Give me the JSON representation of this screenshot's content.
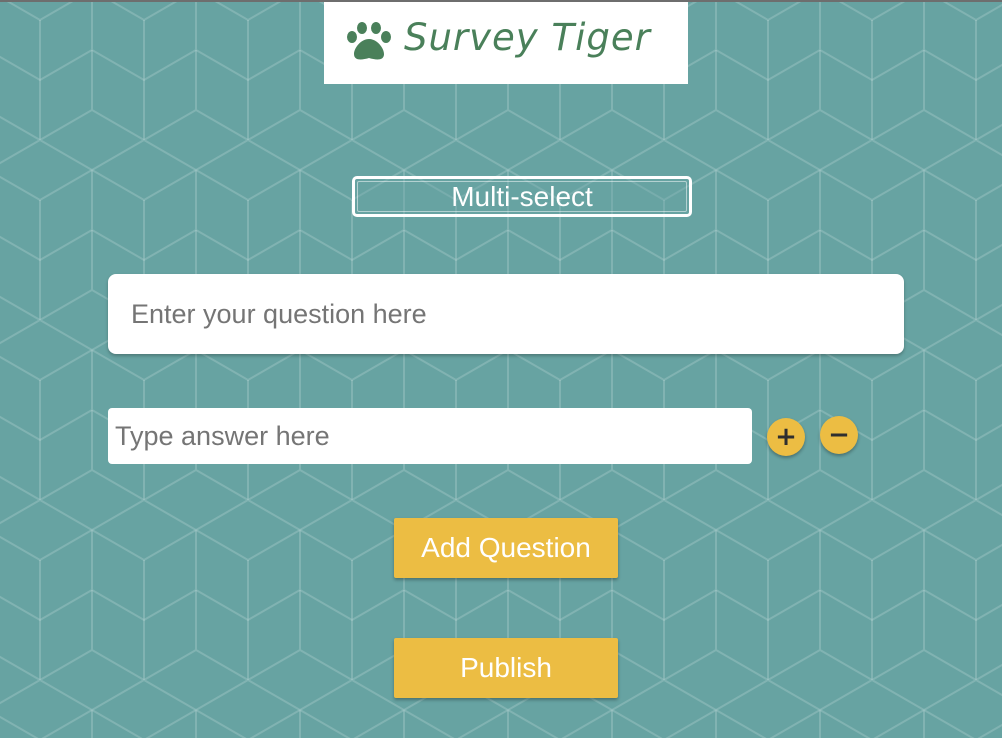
{
  "header": {
    "logo_text": "Survey Tiger",
    "logo_icon": "paw-icon"
  },
  "question_type": {
    "selected_value": "Multi-select"
  },
  "question": {
    "value": "",
    "placeholder": "Enter your question here"
  },
  "answer": {
    "value": "",
    "placeholder": "Type answer here"
  },
  "answer_controls": {
    "add_symbol": "+",
    "remove_symbol": "−"
  },
  "actions": {
    "add_question_label": "Add Question",
    "publish_label": "Publish"
  },
  "colors": {
    "background": "#67a3a2",
    "accent": "#ecbd43",
    "logo_green": "#4a805a"
  }
}
